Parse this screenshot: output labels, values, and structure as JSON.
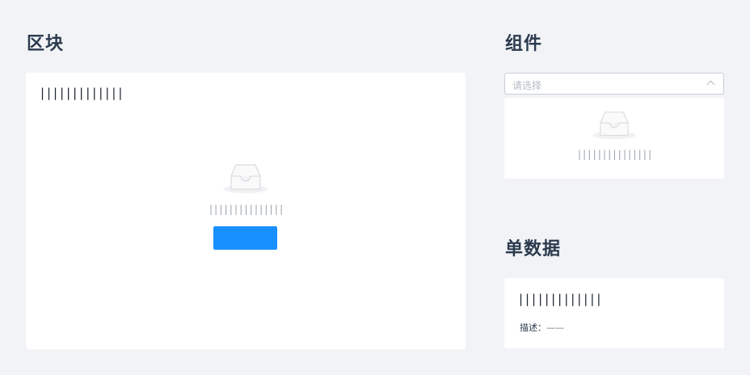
{
  "left": {
    "title": "区块",
    "card": {
      "heading": "|||||||||||||",
      "empty_text": "|||||||||||||||",
      "button_label": ""
    }
  },
  "right_top": {
    "title": "组件",
    "select": {
      "placeholder": "请选择"
    },
    "dropdown": {
      "empty_text": "|||||||||||||||"
    }
  },
  "right_bottom": {
    "title": "单数据",
    "card": {
      "heading": "|||||||||||||",
      "desc_label": "描述",
      "desc_separator": "：",
      "desc_value": "——"
    }
  },
  "colors": {
    "background": "#f1f3f6",
    "card": "#ffffff",
    "primary": "#1890ff",
    "title": "#2b3a4d"
  },
  "icons": [
    "empty-inbox-icon",
    "chevron-up-icon"
  ]
}
